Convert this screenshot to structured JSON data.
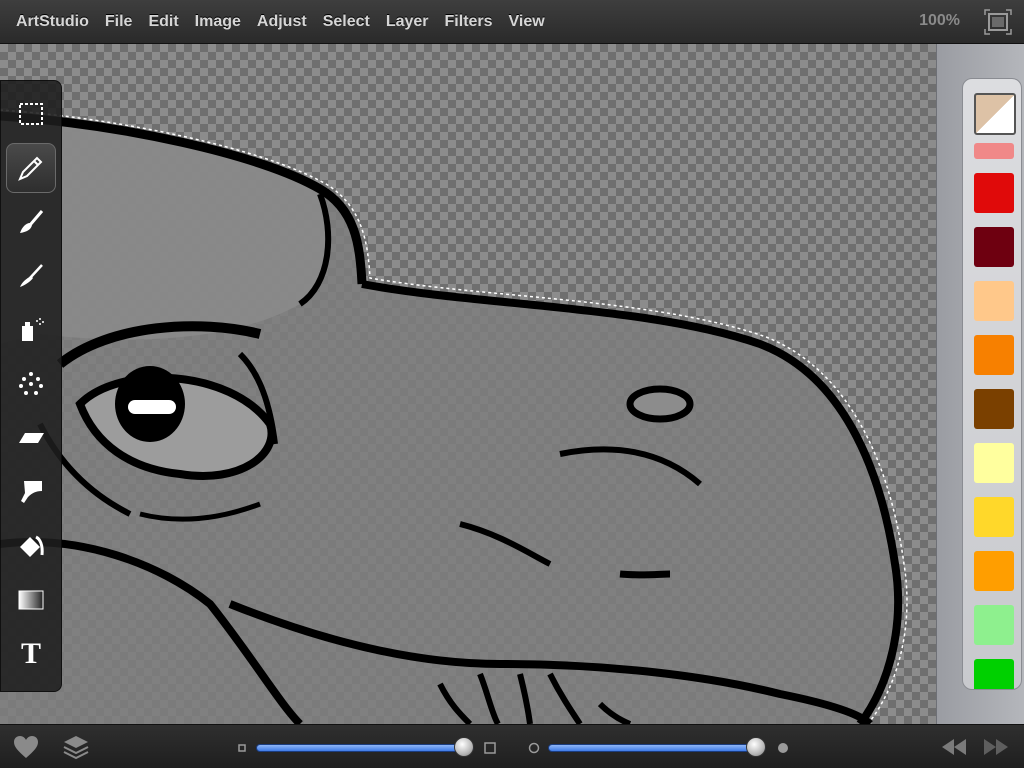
{
  "app": {
    "name": "ArtStudio"
  },
  "menubar": {
    "items": [
      "ArtStudio",
      "File",
      "Edit",
      "Image",
      "Adjust",
      "Select",
      "Layer",
      "Filters",
      "View"
    ],
    "zoom": "100%"
  },
  "toolbar": {
    "tools": [
      {
        "name": "selection-tool",
        "icon": "marquee-icon",
        "active": false
      },
      {
        "name": "pencil-tool",
        "icon": "pencil-icon",
        "active": true
      },
      {
        "name": "brush-tool",
        "icon": "brush-icon",
        "active": false
      },
      {
        "name": "fine-brush-tool",
        "icon": "fine-brush-icon",
        "active": false
      },
      {
        "name": "spray-tool",
        "icon": "spray-can-icon",
        "active": false
      },
      {
        "name": "dots-tool",
        "icon": "dots-icon",
        "active": false
      },
      {
        "name": "eraser-tool",
        "icon": "eraser-icon",
        "active": false
      },
      {
        "name": "smudge-tool",
        "icon": "smudge-icon",
        "active": false
      },
      {
        "name": "fill-tool",
        "icon": "paint-bucket-icon",
        "active": false
      },
      {
        "name": "gradient-tool",
        "icon": "gradient-icon",
        "active": false
      },
      {
        "name": "text-tool",
        "icon": "text-icon",
        "active": false
      }
    ],
    "text_tool_glyph": "T"
  },
  "palette": {
    "current_color": {
      "primary": "#ddc2a6",
      "secondary": "#ffffff"
    },
    "swatches": [
      "#f08888",
      "#e00a0a",
      "#6e0010",
      "#ffc88a",
      "#f78000",
      "#7a4000",
      "#ffff9e",
      "#ffd82a",
      "#ff9e00",
      "#8ef08e",
      "#00d000"
    ]
  },
  "bottombar": {
    "size_slider": {
      "value": 1.0
    },
    "opacity_slider": {
      "value": 1.0
    }
  },
  "colors": {
    "accent": "#3f7be6",
    "menu_text": "#d6d6d6"
  }
}
